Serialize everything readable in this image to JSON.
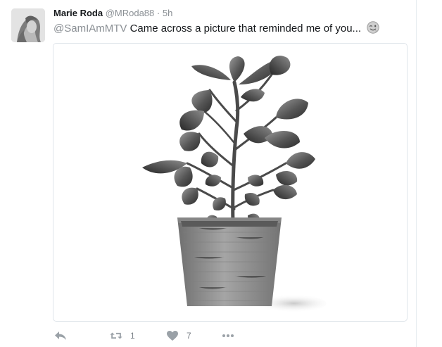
{
  "tweet": {
    "display_name": "Marie Roda",
    "handle": "@MRoda88",
    "separator": "·",
    "time": "5h",
    "mention": "@SamIAmMTV",
    "body": " Came across a picture that reminded me of you...",
    "emoji_icon": "wink-face-icon",
    "avatar_icon": "profile-photo"
  },
  "media": {
    "icon": "potted-plant-image"
  },
  "actions": {
    "reply_icon": "reply-icon",
    "retweet_icon": "retweet-icon",
    "retweet_count": "1",
    "like_icon": "heart-icon",
    "like_count": "7",
    "more_icon": "more-dots-icon"
  },
  "colors": {
    "text": "#14171a",
    "muted": "#8a8f94",
    "border": "#dfe5ea",
    "action_icon": "#9aa1a7"
  }
}
